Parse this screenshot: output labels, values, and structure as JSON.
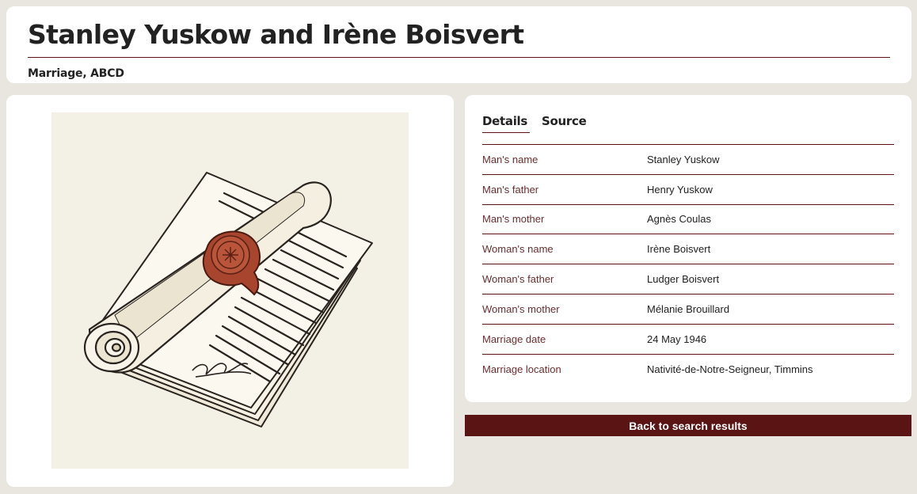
{
  "record": {
    "title": "Stanley Yuskow and Irène Boisvert",
    "subtitle": "Marriage, ABCD"
  },
  "tabs": [
    {
      "label": "Details",
      "active": true
    },
    {
      "label": "Source",
      "active": false
    }
  ],
  "details": [
    {
      "label": "Man's name",
      "value": "Stanley Yuskow"
    },
    {
      "label": "Man's father",
      "value": "Henry Yuskow"
    },
    {
      "label": "Man's mother",
      "value": "Agnès Coulas"
    },
    {
      "label": "Woman's name",
      "value": "Irène Boisvert"
    },
    {
      "label": "Woman's father",
      "value": "Ludger Boisvert"
    },
    {
      "label": "Woman's mother",
      "value": "Mélanie Brouillard"
    },
    {
      "label": "Marriage date",
      "value": "24 May 1946"
    },
    {
      "label": "Marriage location",
      "value": "Nativité-de-Notre-Seigneur, Timmins"
    }
  ],
  "actions": {
    "back_label": "Back to search results"
  },
  "colors": {
    "accent": "#5a1414",
    "page_background": "#e9e6e0",
    "image_background": "#f3f0e6",
    "wax_seal": "#a8452e"
  }
}
